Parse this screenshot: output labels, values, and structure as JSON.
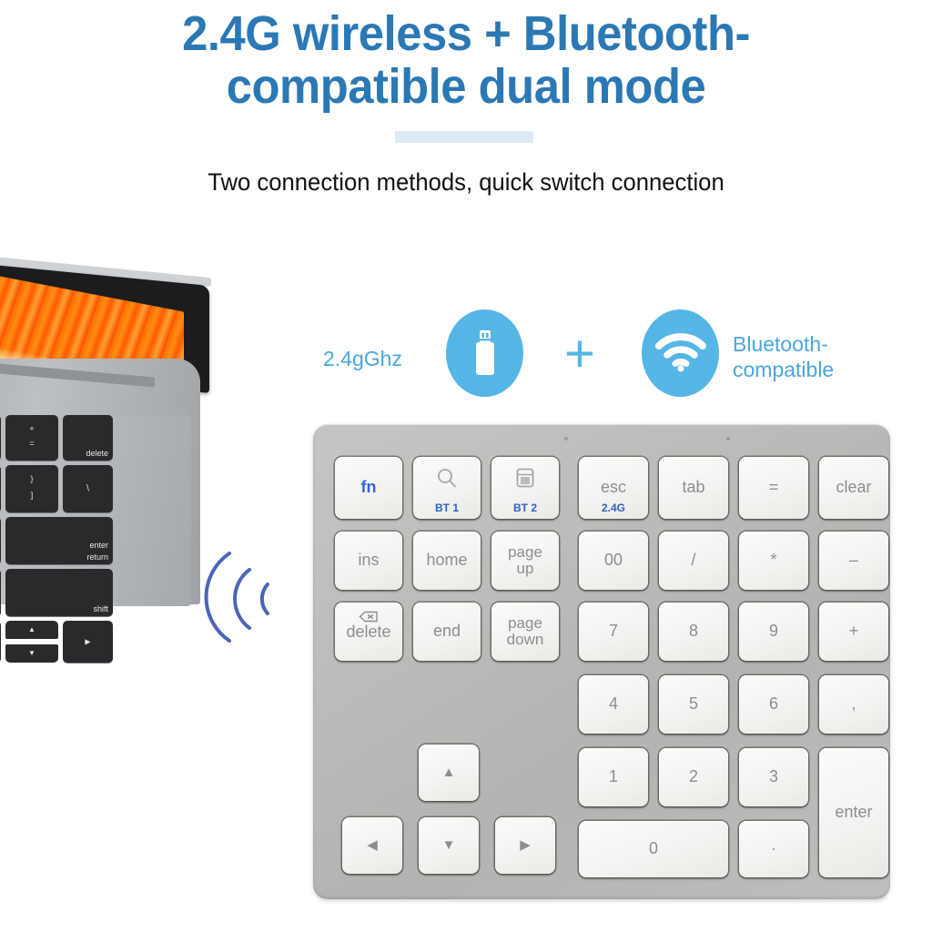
{
  "header": {
    "title_line1": "2.4G wireless + Bluetooth-",
    "title_line2": "compatible dual mode",
    "subtitle": "Two connection methods, quick switch connection",
    "title_color": "#2b78b4",
    "underline_color": "#dceaf7"
  },
  "connection": {
    "left_label": "2.4gGhz",
    "plus": "+",
    "right_label_line1": "Bluetooth-",
    "right_label_line2": "compatible",
    "icon_color": "#55b6e6",
    "label_color": "#4aa7dd",
    "usb_icon": "usb-dongle-icon",
    "wifi_icon": "wifi-signal-icon"
  },
  "laptop": {
    "wallpaper": "orange-wave-wallpaper",
    "keys": [
      {
        "label": "–",
        "label2": "=",
        "type": "two"
      },
      {
        "label": "+",
        "label2": "=",
        "type": "two"
      },
      {
        "label": "delete",
        "type": "right"
      },
      {
        "label": "{",
        "label2": "[",
        "type": "two"
      },
      {
        "label": "}",
        "label2": "]",
        "type": "two"
      },
      {
        "label": "|",
        "label2": "\\",
        "type": "two"
      },
      {
        "label": "\"",
        "label2": "'",
        "type": "two"
      },
      {
        "label": "enter",
        "label2": "return",
        "type": "right2"
      },
      {
        "label": "?",
        "label2": "/",
        "type": "two"
      },
      {
        "label": "shift",
        "type": "right"
      }
    ],
    "arrows": [
      "◀",
      "▲",
      "▼",
      "▶"
    ]
  },
  "signal": {
    "icon": "wireless-waves-icon",
    "color": "#4464b4"
  },
  "keypad": {
    "body_color": "#bdbdbb",
    "key_color": "#f5f5f3",
    "accent_color": "#2f5fc4",
    "leds": 2,
    "keys": [
      {
        "id": "fn",
        "main": "fn",
        "style": "fn"
      },
      {
        "id": "bt1",
        "icon": "search-icon",
        "sub": "BT 1"
      },
      {
        "id": "bt2",
        "icon": "calculator-icon",
        "sub": "BT 2"
      },
      {
        "id": "esc",
        "main": "esc",
        "sub": "2.4G"
      },
      {
        "id": "tab",
        "main": "tab"
      },
      {
        "id": "equals",
        "main": "="
      },
      {
        "id": "clear",
        "main": "clear"
      },
      {
        "id": "ins",
        "main": "ins"
      },
      {
        "id": "home",
        "main": "home"
      },
      {
        "id": "page-up",
        "main": "page",
        "main2": "up"
      },
      {
        "id": "double-zero",
        "main": "00"
      },
      {
        "id": "divide",
        "main": "/"
      },
      {
        "id": "multiply",
        "main": "*"
      },
      {
        "id": "minus",
        "main": "–"
      },
      {
        "id": "delete",
        "icon": "backspace-icon",
        "main": "delete"
      },
      {
        "id": "end",
        "main": "end"
      },
      {
        "id": "page-down",
        "main": "page",
        "main2": "down"
      },
      {
        "id": "num-7",
        "main": "7"
      },
      {
        "id": "num-8",
        "main": "8"
      },
      {
        "id": "num-9",
        "main": "9"
      },
      {
        "id": "plus",
        "main": "+"
      },
      {
        "id": "num-4",
        "main": "4"
      },
      {
        "id": "num-5",
        "main": "5"
      },
      {
        "id": "num-6",
        "main": "6"
      },
      {
        "id": "comma",
        "main": ","
      },
      {
        "id": "num-1",
        "main": "1"
      },
      {
        "id": "num-2",
        "main": "2"
      },
      {
        "id": "num-3",
        "main": "3"
      },
      {
        "id": "enter",
        "main": "enter"
      },
      {
        "id": "arrow-up",
        "main": "▲"
      },
      {
        "id": "arrow-left",
        "main": "◀"
      },
      {
        "id": "arrow-down",
        "main": "▼"
      },
      {
        "id": "arrow-right",
        "main": "▶"
      },
      {
        "id": "num-0",
        "main": "0"
      },
      {
        "id": "decimal",
        "main": "·"
      }
    ]
  }
}
